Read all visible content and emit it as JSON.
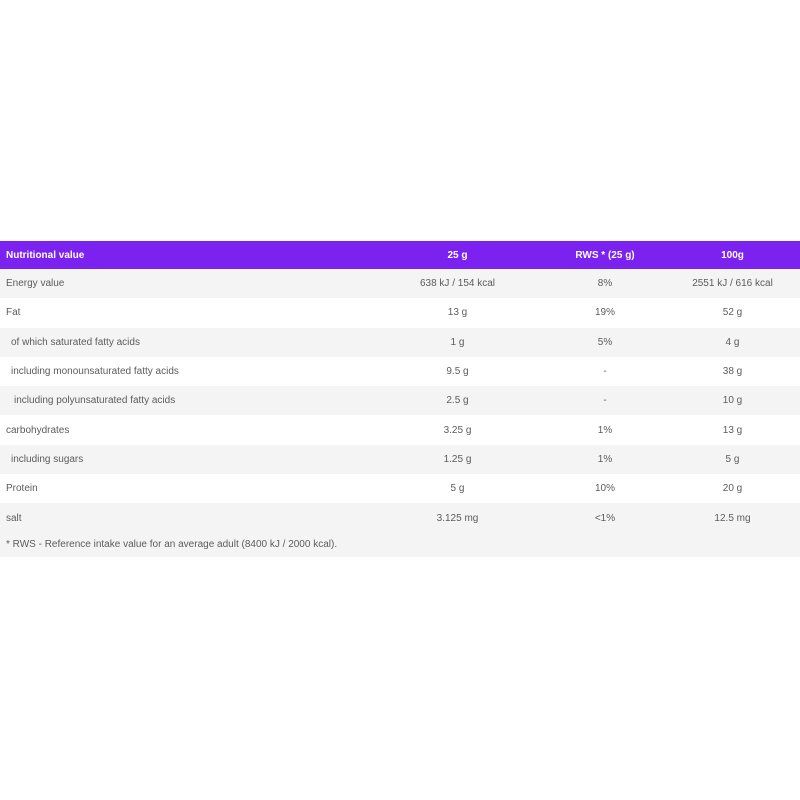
{
  "header": {
    "col_name": "Nutritional value",
    "col_25g": "25 g",
    "col_rws": "RWS * (25 g)",
    "col_100g": "100g"
  },
  "rows": [
    {
      "name": "Energy value",
      "per25": "638 kJ / 154 kcal",
      "rws": "8%",
      "per100": "2551 kJ / 616 kcal",
      "indent": 0
    },
    {
      "name": "Fat",
      "per25": "13 g",
      "rws": "19%",
      "per100": "52 g",
      "indent": 0
    },
    {
      "name": "of which saturated fatty acids",
      "per25": "1 g",
      "rws": "5%",
      "per100": "4 g",
      "indent": 1
    },
    {
      "name": "including monounsaturated fatty acids",
      "per25": "9.5 g",
      "rws": "-",
      "per100": "38 g",
      "indent": 1
    },
    {
      "name": "including polyunsaturated fatty acids",
      "per25": "2.5 g",
      "rws": "-",
      "per100": "10 g",
      "indent": 2
    },
    {
      "name": "carbohydrates",
      "per25": "3.25 g",
      "rws": "1%",
      "per100": "13 g",
      "indent": 0
    },
    {
      "name": "including sugars",
      "per25": "1.25 g",
      "rws": "1%",
      "per100": "5 g",
      "indent": 1
    },
    {
      "name": "Protein",
      "per25": "5 g",
      "rws": "10%",
      "per100": "20 g",
      "indent": 0
    },
    {
      "name": "salt",
      "per25": "3.125 mg",
      "rws": "<1%",
      "per100": "12.5 mg",
      "indent": 0
    }
  ],
  "footnote": "* RWS - Reference intake value for an average adult (8400 kJ / 2000 kcal).",
  "colors": {
    "header_bg": "#7b22f0",
    "header_text": "#ffffff",
    "row_alt": "#f4f4f4",
    "text": "#5c5c5c"
  }
}
